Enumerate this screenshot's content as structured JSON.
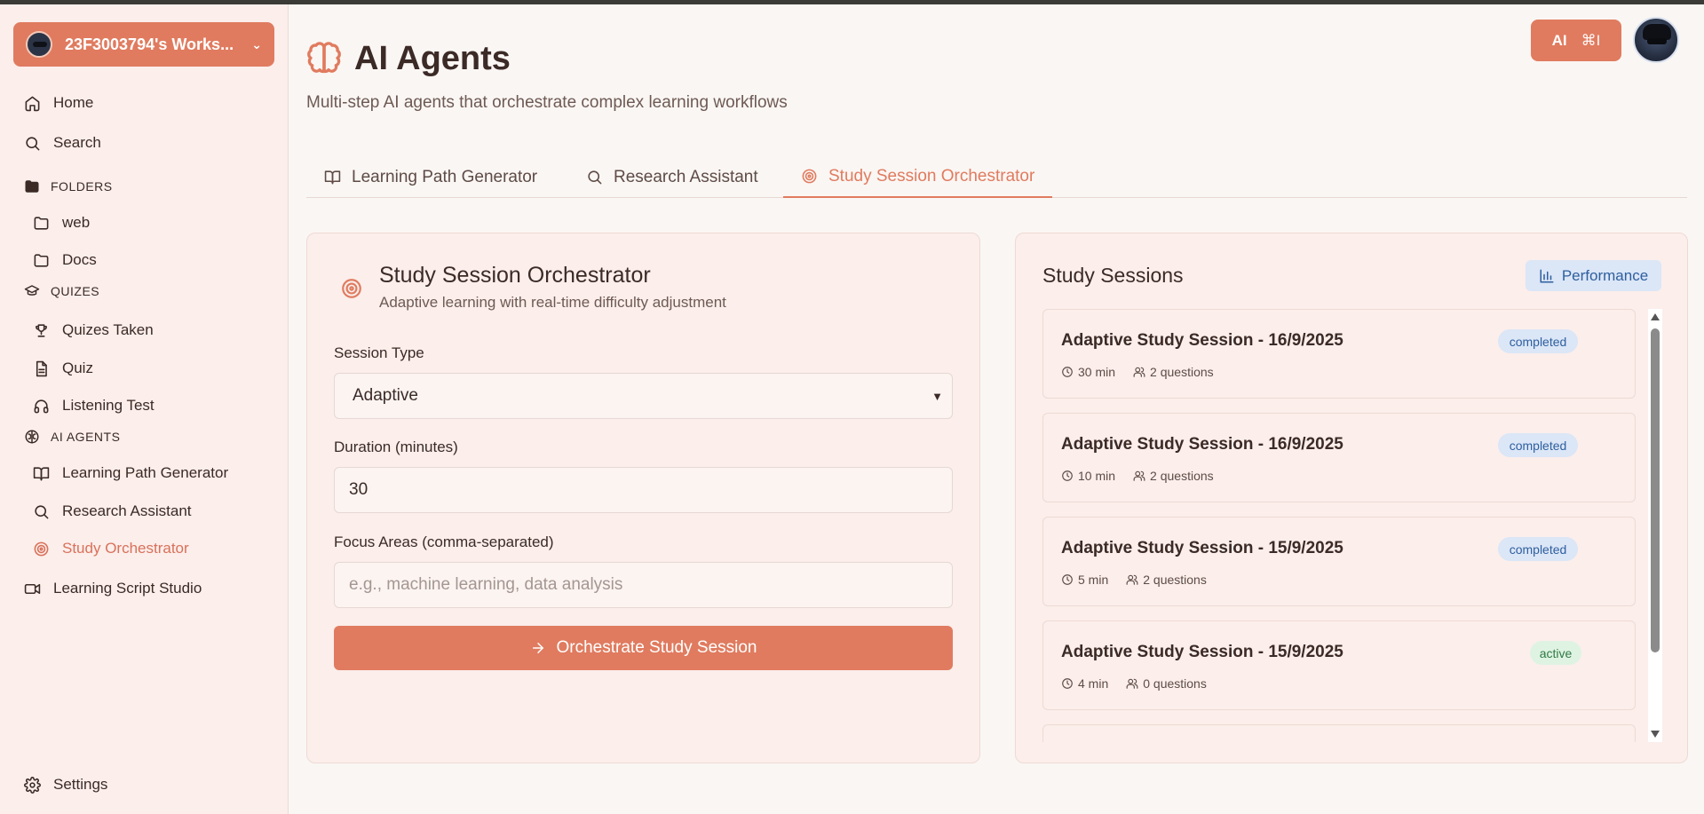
{
  "workspace": {
    "name": "23F3003794's Works..."
  },
  "nav": {
    "home": "Home",
    "search": "Search",
    "folders_label": "FOLDERS",
    "folders": [
      "web",
      "Docs"
    ],
    "quizzes_label": "QUIZES",
    "quizzes": [
      "Quizes Taken",
      "Quiz",
      "Listening Test"
    ],
    "agents_label": "AI AGENTS",
    "agents": [
      "Learning Path Generator",
      "Research Assistant",
      "Study Orchestrator"
    ],
    "studio": "Learning Script Studio",
    "settings": "Settings"
  },
  "header": {
    "title": "AI Agents",
    "subtitle": "Multi-step AI agents that orchestrate complex learning workflows",
    "ai_button": "AI",
    "ai_shortcut": "⌘I"
  },
  "tabs": [
    "Learning Path Generator",
    "Research Assistant",
    "Study Session Orchestrator"
  ],
  "orchestrator": {
    "title": "Study Session Orchestrator",
    "subtitle": "Adaptive learning with real-time difficulty adjustment",
    "session_type_label": "Session Type",
    "session_type_value": "Adaptive",
    "duration_label": "Duration (minutes)",
    "duration_value": "30",
    "focus_label": "Focus Areas (comma-separated)",
    "focus_placeholder": "e.g., machine learning, data analysis",
    "submit_label": "Orchestrate Study Session"
  },
  "sessions": {
    "title": "Study Sessions",
    "performance_label": "Performance",
    "items": [
      {
        "title": "Adaptive Study Session - 16/9/2025",
        "duration": "30 min",
        "questions": "2 questions",
        "status": "completed"
      },
      {
        "title": "Adaptive Study Session - 16/9/2025",
        "duration": "10 min",
        "questions": "2 questions",
        "status": "completed"
      },
      {
        "title": "Adaptive Study Session - 15/9/2025",
        "duration": "5 min",
        "questions": "2 questions",
        "status": "completed"
      },
      {
        "title": "Adaptive Study Session - 15/9/2025",
        "duration": "4 min",
        "questions": "0 questions",
        "status": "active"
      }
    ]
  },
  "colors": {
    "accent": "#e07b5f",
    "sidebar_bg": "#fbeeeb",
    "page_bg": "#faf6f3",
    "badge_completed": "#dbe6f7",
    "badge_active": "#dff3e3"
  }
}
